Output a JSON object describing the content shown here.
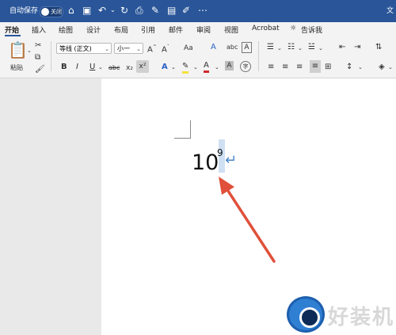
{
  "titlebar": {
    "autosave_label": "自动保存",
    "autosave_state": "关闭",
    "title_fragment": "文"
  },
  "menu": {
    "tabs": [
      "开始",
      "插入",
      "绘图",
      "设计",
      "布局",
      "引用",
      "邮件",
      "审阅",
      "视图",
      "Acrobat"
    ],
    "tell_me": "告诉我",
    "active_tab": "开始"
  },
  "ribbon": {
    "paste_label": "粘贴",
    "font_name": "等线 (正文)",
    "font_size": "小一",
    "font_aa": "Aa",
    "bold": "B",
    "italic": "I",
    "underline": "U",
    "strikethrough": "abc",
    "subscript": "x₂",
    "superscript": "x²",
    "text_effect": "A",
    "font_color": "A",
    "char_shading": "A",
    "enclose": "字"
  },
  "document": {
    "base_text": "10",
    "superscript_text": "9",
    "paragraph_mark": "↵"
  },
  "watermark": {
    "text": "好装机"
  },
  "colors": {
    "titlebar": "#2a5699",
    "arrow": "#e0503a",
    "selection": "#cfe0f3"
  }
}
